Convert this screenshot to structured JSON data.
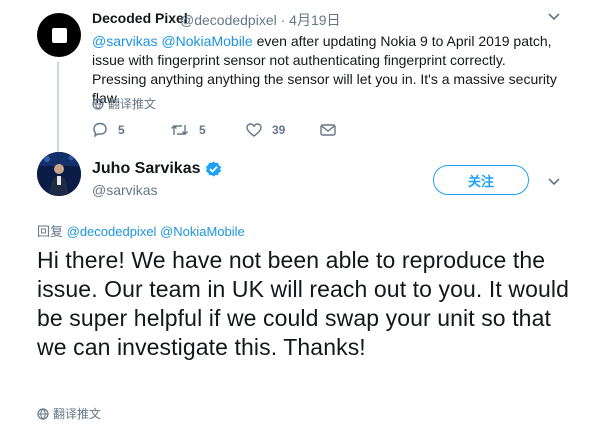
{
  "tweet1": {
    "name": "Decoded Pixel",
    "handle_date": "@decodedpixel · 4月19日",
    "mention1": "@sarvikas",
    "mention2": "@NokiaMobile",
    "text": " even after updating Nokia 9 to April 2019 patch, issue with fingerprint sensor not authenticating fingerprint correctly. Pressing anything anything the sensor will let you in. It's a massive security flaw.",
    "translate": "翻译推文",
    "replies": "5",
    "retweets": "5",
    "likes": "39"
  },
  "tweet2": {
    "name": "Juho Sarvikas",
    "handle": "@sarvikas",
    "follow_label": "关注",
    "replying_prefix": "回复 ",
    "replying_to": "@decodedpixel @NokiaMobile",
    "text": "Hi there! We have not been able to reproduce the issue. Our team in UK will reach out to you. It would be super helpful if we could swap your unit so that we can investigate this. Thanks!",
    "translate": "翻译推文"
  },
  "colors": {
    "accent": "#1da1f2",
    "mention": "#1b95e0",
    "muted": "#657786",
    "text": "#14171a"
  }
}
